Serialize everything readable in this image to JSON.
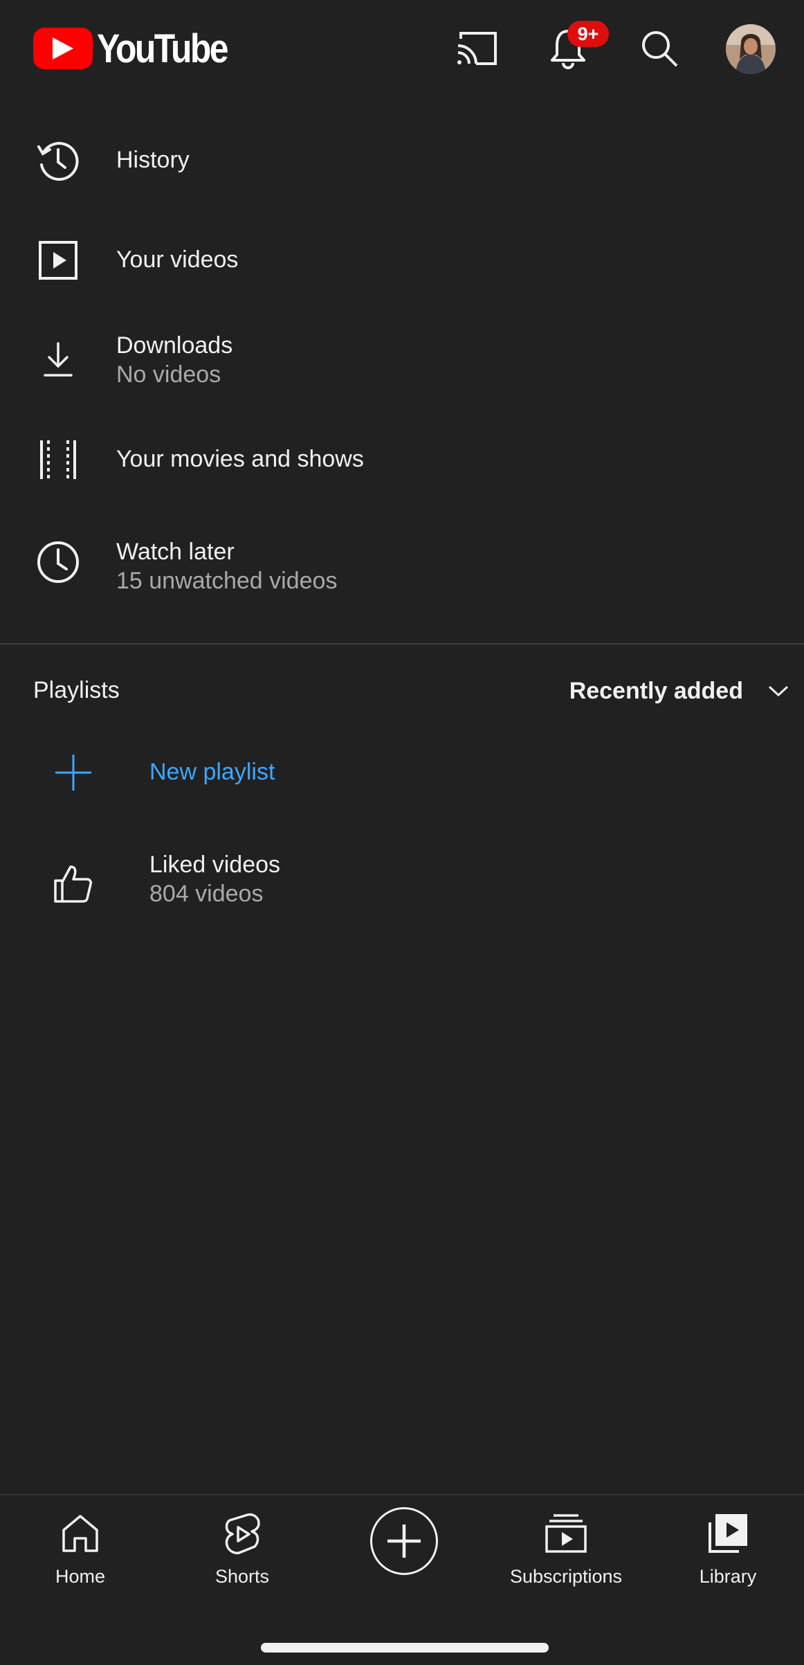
{
  "header": {
    "logo_text": "YouTube",
    "notification_badge": "9+",
    "icons": [
      "youtube-logo-icon",
      "cast-icon",
      "bell-icon",
      "search-icon",
      "avatar"
    ]
  },
  "menu": {
    "items": [
      {
        "title": "History",
        "subtitle": "",
        "icon": "history-icon"
      },
      {
        "title": "Your videos",
        "subtitle": "",
        "icon": "play-square-icon"
      },
      {
        "title": "Downloads",
        "subtitle": "No videos",
        "icon": "download-icon"
      },
      {
        "title": "Your movies and shows",
        "subtitle": "",
        "icon": "film-strip-icon"
      },
      {
        "title": "Watch later",
        "subtitle": "15 unwatched videos",
        "icon": "clock-icon"
      }
    ]
  },
  "playlists": {
    "title": "Playlists",
    "sort_label": "Recently added",
    "new_playlist_label": "New playlist",
    "items": [
      {
        "title": "Liked videos",
        "subtitle": "804 videos",
        "icon": "thumbs-up-icon"
      }
    ]
  },
  "bottom_nav": {
    "items": [
      {
        "label": "Home",
        "icon": "home-icon"
      },
      {
        "label": "Shorts",
        "icon": "shorts-icon"
      },
      {
        "label": "",
        "icon": "create-plus-icon"
      },
      {
        "label": "Subscriptions",
        "icon": "subscriptions-icon"
      },
      {
        "label": "Library",
        "icon": "library-icon"
      }
    ]
  },
  "colors": {
    "background": "#212121",
    "brand_red": "#ff0000",
    "accent_blue": "#3ea6ff",
    "text_primary": "#f1f1f1",
    "text_secondary": "#aaaaaa",
    "badge_red": "#e00d0d"
  }
}
